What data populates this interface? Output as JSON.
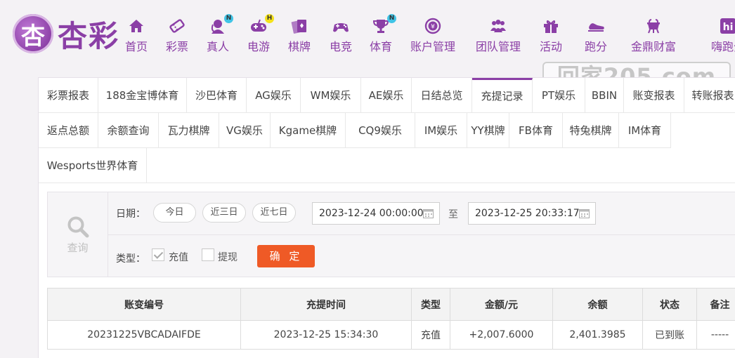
{
  "brand": {
    "logo_glyph": "杏",
    "name": "杏彩"
  },
  "nav": [
    {
      "label": "首页",
      "icon": "home-icon"
    },
    {
      "label": "彩票",
      "icon": "lottery-ticket-icon"
    },
    {
      "label": "真人",
      "icon": "live-dealer-icon",
      "badge": "N"
    },
    {
      "label": "电游",
      "icon": "gamepad-icon",
      "badge": "H"
    },
    {
      "label": "棋牌",
      "icon": "cards-icon"
    },
    {
      "label": "电竞",
      "icon": "esports-controller-icon"
    },
    {
      "label": "体育",
      "icon": "trophy-icon",
      "badge": "N"
    },
    {
      "label": "账户管理",
      "icon": "yen-coin-icon"
    },
    {
      "label": "团队管理",
      "icon": "team-icon"
    },
    {
      "label": "活动",
      "icon": "gift-icon"
    },
    {
      "label": "跑分",
      "icon": "running-shoe-icon"
    },
    {
      "label": "金鼎财富",
      "icon": "ding-vessel-icon"
    },
    {
      "label": "嗨跑分",
      "icon": "hi-icon"
    }
  ],
  "watermark": {
    "text": "回家205.com"
  },
  "tabs": [
    "彩票报表",
    "188金宝博体育",
    "沙巴体育",
    "AG娱乐",
    "WM娱乐",
    "AE娱乐",
    "日结总览",
    "充提记录",
    "PT娱乐",
    "BBIN",
    "账变报表",
    "转账报表",
    "返点总额",
    "余额查询",
    "瓦力棋牌",
    "VG娱乐",
    "Kgame棋牌",
    "CQ9娱乐",
    "IM娱乐",
    "YY棋牌",
    "FB体育",
    "特兔棋牌",
    "IM体育",
    "Wesports世界体育"
  ],
  "active_tab": "充提记录",
  "query": {
    "side_label": "查询",
    "date_label": "日期：",
    "quick_ranges": [
      "今日",
      "近三日",
      "近七日"
    ],
    "start": "2023-12-24 00:00:00",
    "to_label": "至",
    "end": "2023-12-25 20:33:17",
    "type_label": "类型：",
    "types": [
      {
        "label": "充值",
        "checked": true
      },
      {
        "label": "提现",
        "checked": false
      }
    ],
    "submit": "确 定"
  },
  "table": {
    "headers": [
      "账变编号",
      "充提时间",
      "类型",
      "金额/元",
      "余额",
      "状态",
      "备注"
    ],
    "rows": [
      [
        "20231225VBCADAIFDE",
        "2023-12-25 15:34:30",
        "充值",
        "+2,007.6000",
        "2,401.3985",
        "已到账",
        "-----"
      ]
    ]
  },
  "colors": {
    "brand": "#8b3fa6",
    "submit": "#ef5a26",
    "amount": "#c9262a",
    "status_ok": "#2fa52f"
  }
}
